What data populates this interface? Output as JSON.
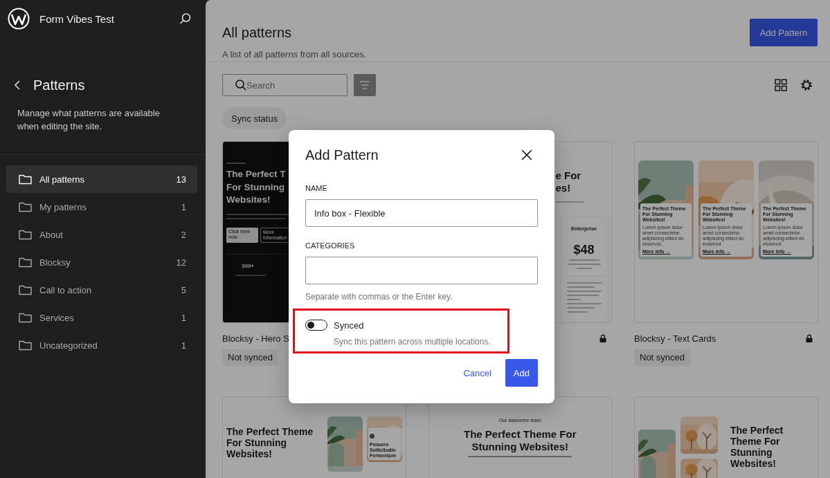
{
  "sidebar": {
    "site_title": "Form Vibes Test",
    "section_title": "Patterns",
    "description": "Manage what patterns are available when editing the site.",
    "items": [
      {
        "label": "All patterns",
        "count": "13",
        "selected": true
      },
      {
        "label": "My patterns",
        "count": "1",
        "selected": false
      },
      {
        "label": "About",
        "count": "2",
        "selected": false
      },
      {
        "label": "Blocksy",
        "count": "12",
        "selected": false
      },
      {
        "label": "Call to action",
        "count": "5",
        "selected": false
      },
      {
        "label": "Services",
        "count": "1",
        "selected": false
      },
      {
        "label": "Uncategorized",
        "count": "1",
        "selected": false
      }
    ]
  },
  "header": {
    "title": "All patterns",
    "subtitle": "A list of all patterns from all sources.",
    "add_button": "Add Pattern"
  },
  "toolbar": {
    "search_placeholder": "Search",
    "filter_chip": "Sync status"
  },
  "patterns": [
    {
      "title": "Blocksy - Hero S",
      "badge": "Not synced",
      "preview": {
        "kind": "hero_dark",
        "heading": [
          "The Perfect T",
          "For Stunning",
          "Websites!"
        ],
        "buttons": [
          "Click here now",
          "More information"
        ],
        "stat": "300+"
      }
    },
    {
      "locked": true,
      "preview": {
        "kind": "pricing",
        "heading": [
          "e For",
          "es!"
        ],
        "plan": "Enterprise",
        "price": "$48"
      }
    },
    {
      "title": "Blocksy - Text Cards",
      "locked": true,
      "badge": "Not synced",
      "preview": {
        "kind": "text_cards",
        "cards": [
          {
            "heading": "The Perfect Theme For Stunning Websites!",
            "text": "Lorem ipsum dolor amet consectetur adipiscing elited do eiusmod.",
            "link": "More info →"
          },
          {
            "heading": "The Perfect Theme For Stunning Websites!",
            "text": "Lorem ipsum dolor amet consectetur adipiscing elited do eiusmod.",
            "link": "More info →"
          },
          {
            "heading": "The Perfect Theme For Stunning Websites!",
            "text": "Lorem ipsum dolor amet consectetur adipiscing elited do eiusmod.",
            "link": "More info →"
          }
        ]
      }
    },
    {
      "preview": {
        "kind": "hero_gallery",
        "heading": "The Perfect Theme For Stunning Websites!",
        "caption": "Posuere Sollicitudin Fermentum"
      }
    },
    {
      "preview": {
        "kind": "team",
        "eyebrow": "Our awesome team",
        "heading": "The Perfect Theme For Stunning Websites!"
      }
    },
    {
      "preview": {
        "kind": "gallery_text",
        "heading": "The Perfect Theme For Stunning Websites!"
      }
    }
  ],
  "modal": {
    "title": "Add Pattern",
    "name_label": "NAME",
    "name_value": "Info box - Flexible",
    "categories_label": "CATEGORIES",
    "categories_help": "Separate with commas or the Enter key.",
    "sync": {
      "label": "Synced",
      "description": "Sync this pattern across multiple locations.",
      "on": false,
      "highlighted": true
    },
    "buttons": [
      {
        "label": "Cancel",
        "kind": "link"
      },
      {
        "label": "Add",
        "kind": "primary"
      }
    ]
  }
}
